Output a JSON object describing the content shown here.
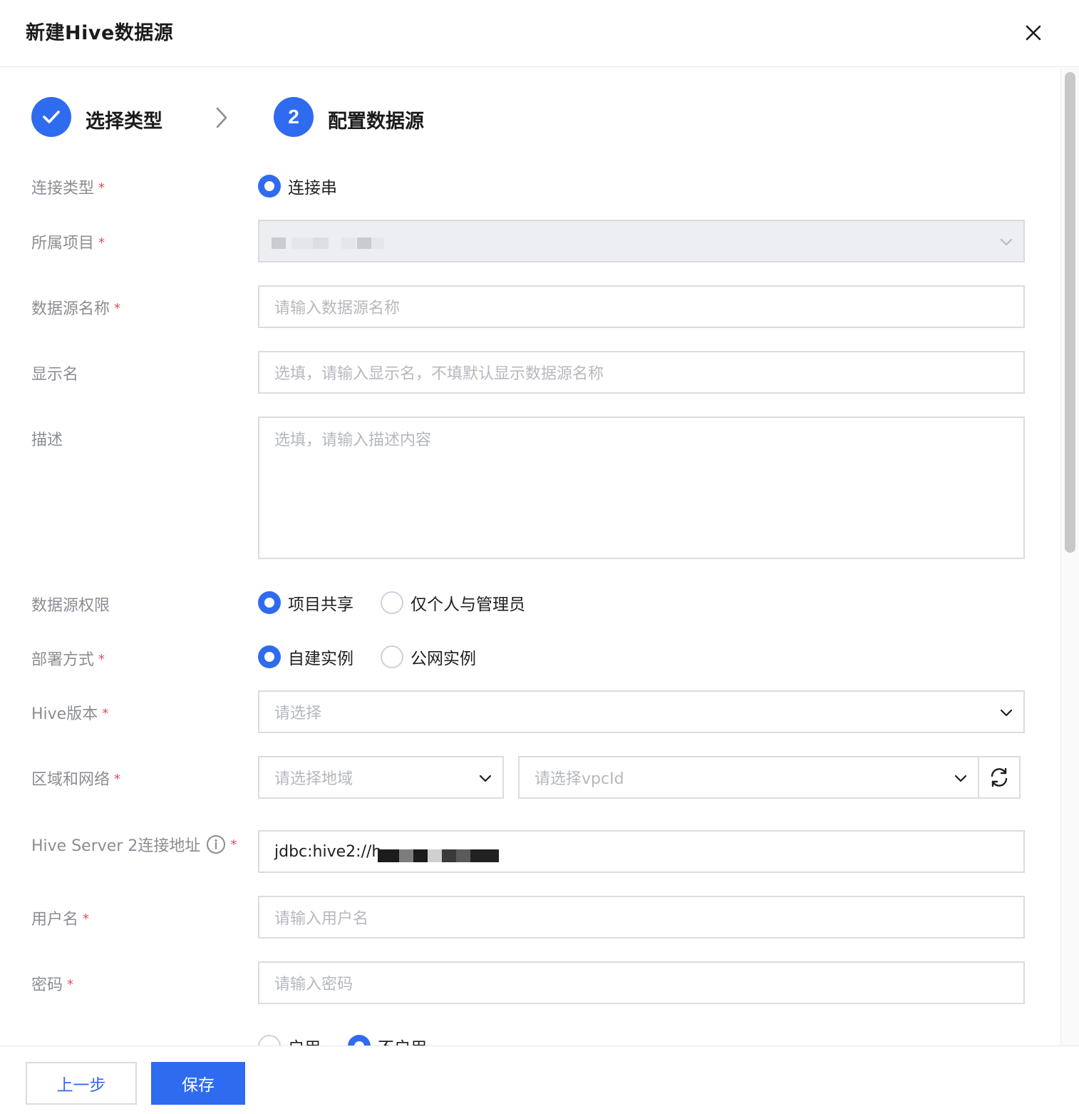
{
  "dialog": {
    "title": "新建Hive数据源"
  },
  "steps": [
    {
      "label": "选择类型",
      "state": "done"
    },
    {
      "number": "2",
      "label": "配置数据源",
      "state": "active"
    }
  ],
  "form": {
    "connection_type": {
      "label": "连接类型",
      "options": [
        "连接串"
      ],
      "selected": "连接串"
    },
    "project": {
      "label": "所属项目",
      "disabled": true
    },
    "datasource_name": {
      "label": "数据源名称",
      "placeholder": "请输入数据源名称"
    },
    "display_name": {
      "label": "显示名",
      "placeholder": "选填，请输入显示名，不填默认显示数据源名称"
    },
    "description": {
      "label": "描述",
      "placeholder": "选填，请输入描述内容"
    },
    "permission": {
      "label": "数据源权限",
      "options": [
        "项目共享",
        "仅个人与管理员"
      ],
      "selected": "项目共享"
    },
    "deployment": {
      "label": "部署方式",
      "options": [
        "自建实例",
        "公网实例"
      ],
      "selected": "自建实例"
    },
    "hive_version": {
      "label": "Hive版本",
      "placeholder": "请选择"
    },
    "region_network": {
      "label": "区域和网络",
      "region_placeholder": "请选择地域",
      "vpc_placeholder": "请选择vpcId"
    },
    "hive_server2": {
      "label": "Hive Server 2连接地址",
      "value": "jdbc:hive2://h"
    },
    "username": {
      "label": "用户名",
      "placeholder": "请输入用户名"
    },
    "password": {
      "label": "密码",
      "placeholder": "请输入密码"
    },
    "partial_row": {
      "options": [
        "启用",
        "不启用"
      ],
      "selected": "不启用"
    }
  },
  "footer": {
    "prev_label": "上一步",
    "save_label": "保存"
  },
  "colors": {
    "primary": "#2f6bef",
    "required": "#e34d59",
    "placeholder": "#b5b8be",
    "label": "#8a8d93"
  }
}
